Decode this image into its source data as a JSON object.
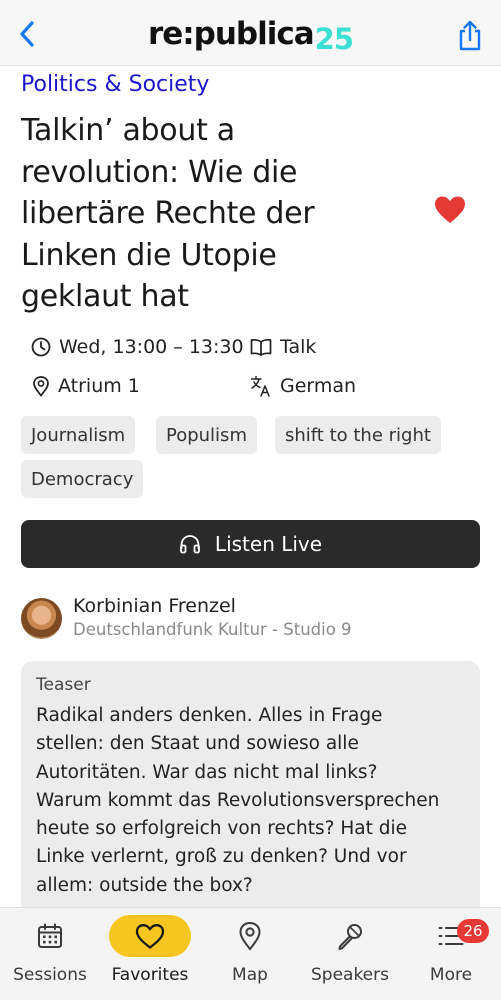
{
  "header": {
    "logo_main": "re:publica",
    "logo_accent": "25",
    "accent_color": "#3be0d2"
  },
  "session": {
    "category": "Politics & Society",
    "title_lines": [
      "Talkin’ about a",
      "revolution: Wie die",
      "libertäre Rechte der",
      "Linken die Utopie",
      "geklaut hat"
    ],
    "time": "Wed, 13:00 – 13:30",
    "format": "Talk",
    "location": "Atrium 1",
    "language": "German",
    "favorited": true,
    "tags": [
      "Journalism",
      "Populism",
      "shift to the right",
      "Democracy"
    ]
  },
  "listen": {
    "label": "Listen Live"
  },
  "speaker": {
    "name": "Korbinian Frenzel",
    "organization": "Deutschlandfunk Kultur - Studio 9"
  },
  "teaser": {
    "label": "Teaser",
    "lines": [
      "Radikal anders denken. Alles in Frage",
      "stellen: den Staat und sowieso alle",
      "Autoritäten. War das nicht mal links?",
      "Warum kommt das Revolutionsversprechen",
      "heute so erfolgreich von rechts? Hat die",
      "Linke verlernt, groß zu denken? Und vor",
      "allem: outside the box?"
    ]
  },
  "tabbar": {
    "tabs": [
      {
        "label": "Sessions",
        "icon": "calendar-icon"
      },
      {
        "label": "Favorites",
        "icon": "heart-icon",
        "active": true
      },
      {
        "label": "Map",
        "icon": "map-pin-icon"
      },
      {
        "label": "Speakers",
        "icon": "microphone-icon"
      },
      {
        "label": "More",
        "icon": "list-icon",
        "badge": "26"
      }
    ]
  },
  "colors": {
    "category": "#1b17c9",
    "favorite": "#e53935",
    "active_tab": "#f7c520",
    "button_bg": "#2b2a2a"
  }
}
